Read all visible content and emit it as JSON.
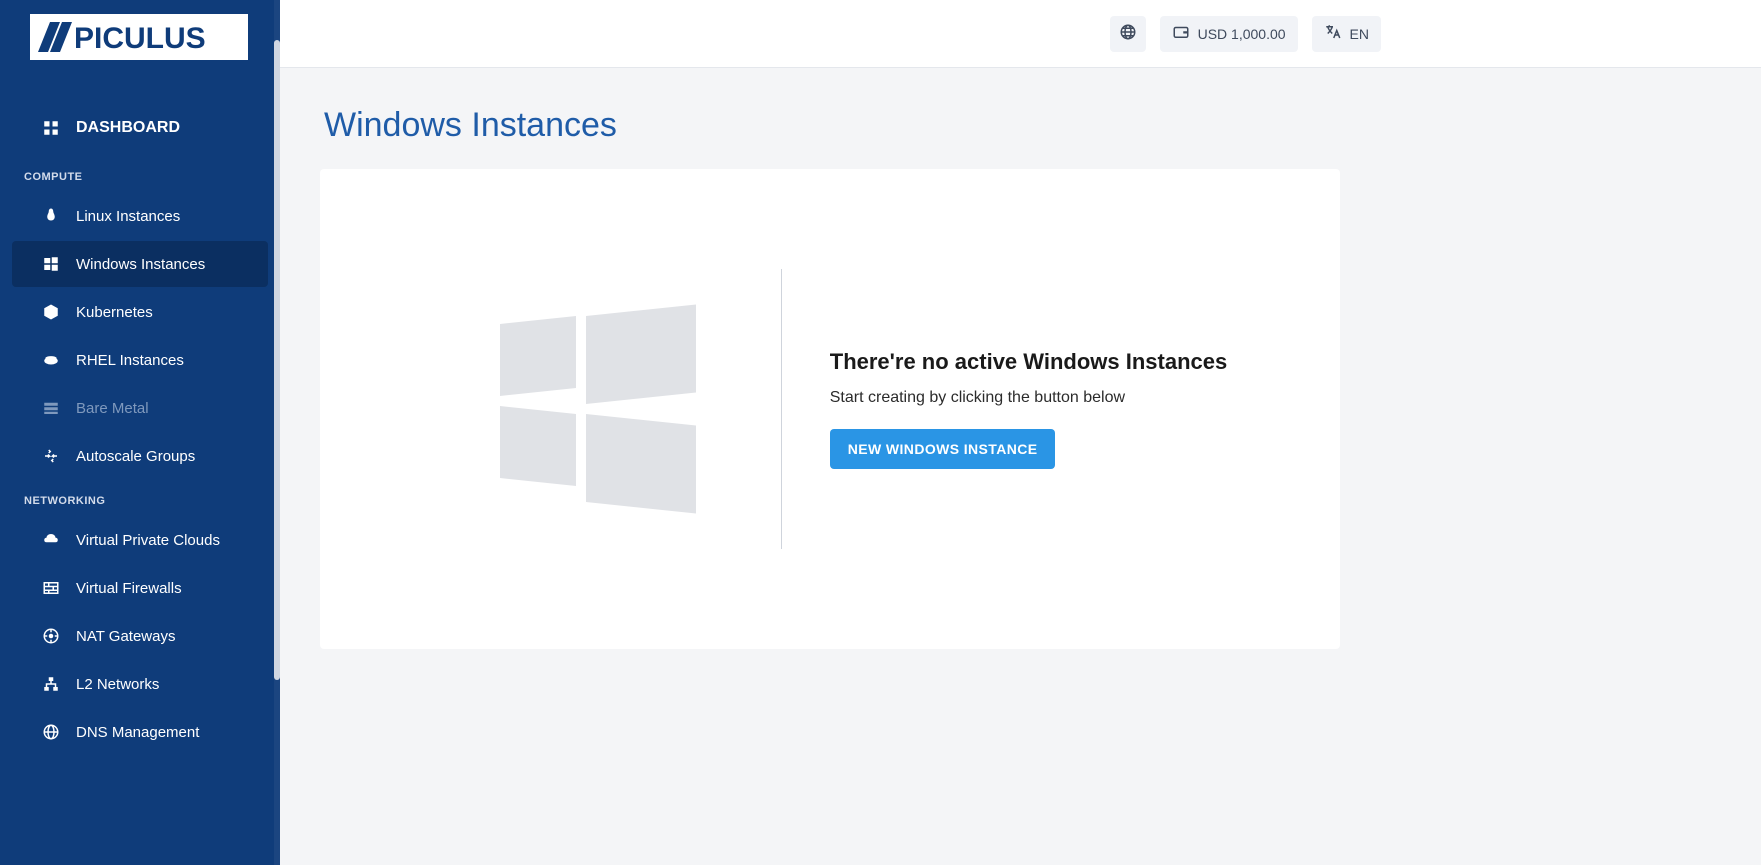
{
  "brand": {
    "name": "APICULUS"
  },
  "sidebar": {
    "dashboard_label": "DASHBOARD",
    "sections": {
      "compute": {
        "title": "COMPUTE",
        "items": [
          {
            "label": "Linux Instances",
            "icon": "linux-icon",
            "active": false,
            "disabled": false
          },
          {
            "label": "Windows Instances",
            "icon": "windows-icon",
            "active": true,
            "disabled": false
          },
          {
            "label": "Kubernetes",
            "icon": "kubernetes-icon",
            "active": false,
            "disabled": false
          },
          {
            "label": "RHEL Instances",
            "icon": "redhat-icon",
            "active": false,
            "disabled": false
          },
          {
            "label": "Bare Metal",
            "icon": "baremetal-icon",
            "active": false,
            "disabled": true
          },
          {
            "label": "Autoscale Groups",
            "icon": "autoscale-icon",
            "active": false,
            "disabled": false
          }
        ]
      },
      "networking": {
        "title": "NETWORKING",
        "items": [
          {
            "label": "Virtual Private Clouds",
            "icon": "vpc-icon",
            "active": false,
            "disabled": false
          },
          {
            "label": "Virtual Firewalls",
            "icon": "firewall-icon",
            "active": false,
            "disabled": false
          },
          {
            "label": "NAT Gateways",
            "icon": "nat-icon",
            "active": false,
            "disabled": false
          },
          {
            "label": "L2 Networks",
            "icon": "l2network-icon",
            "active": false,
            "disabled": false
          },
          {
            "label": "DNS Management",
            "icon": "dns-icon",
            "active": false,
            "disabled": false
          }
        ]
      }
    }
  },
  "topbar": {
    "balance_label": "USD 1,000.00",
    "language_label": "EN"
  },
  "page": {
    "title": "Windows Instances",
    "empty": {
      "heading": "There're no active Windows Instances",
      "subtext": "Start creating by clicking the button below",
      "button_label": "NEW WINDOWS INSTANCE"
    }
  },
  "colors": {
    "sidebar_bg": "#0f3c7a",
    "accent_blue": "#2a95e5",
    "title_blue": "#1f5ca8"
  }
}
